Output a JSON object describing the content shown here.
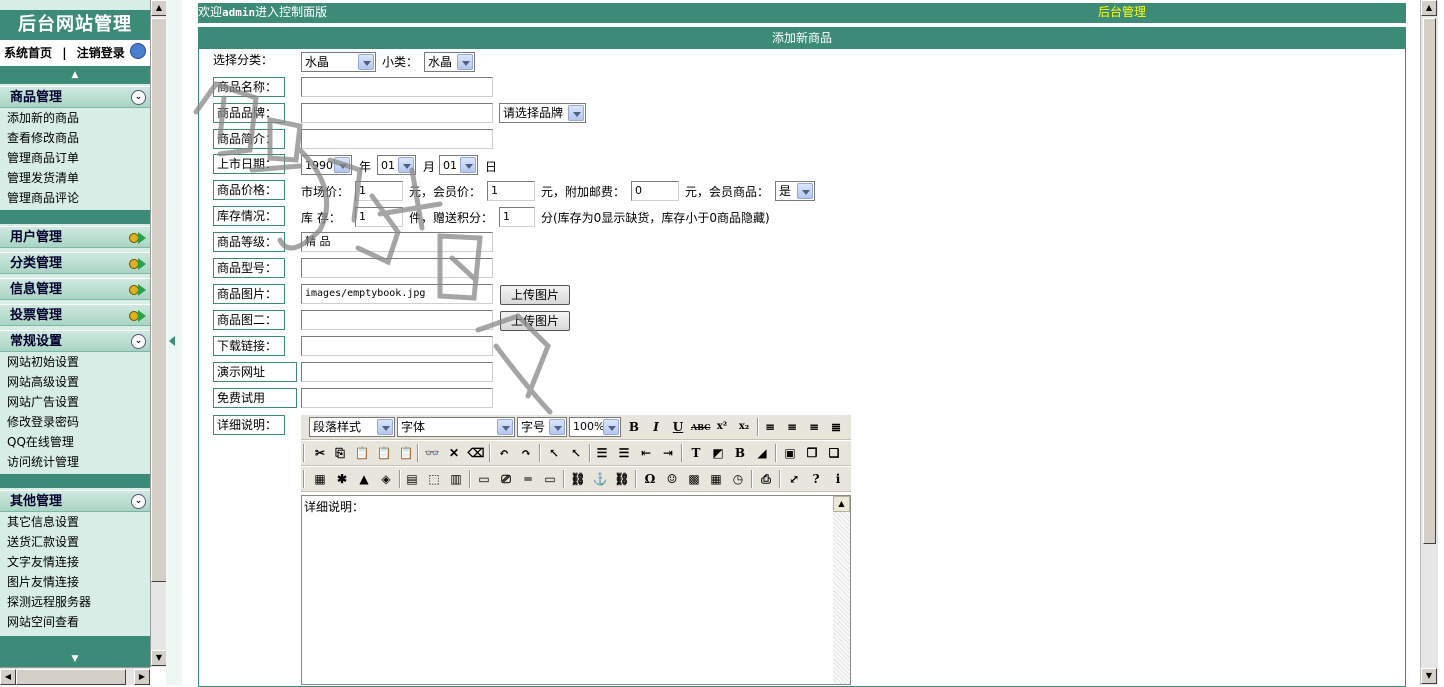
{
  "left": {
    "title": "后台网站管理",
    "home": "系统首页",
    "sep": "|",
    "logout": "注销登录",
    "groups": [
      {
        "label": "商品管理",
        "icon": "collapse-icon",
        "items": [
          "添加新的商品",
          "查看修改商品",
          "管理商品订单",
          "管理发货清单",
          "管理商品评论"
        ]
      },
      {
        "label": "用户管理",
        "icon": "expand-icon",
        "items": []
      },
      {
        "label": "分类管理",
        "icon": "expand-icon",
        "items": []
      },
      {
        "label": "信息管理",
        "icon": "expand-icon",
        "items": []
      },
      {
        "label": "投票管理",
        "icon": "expand-icon",
        "items": []
      },
      {
        "label": "常规设置",
        "icon": "collapse-icon",
        "items": [
          "网站初始设置",
          "网站高级设置",
          "网站广告设置",
          "修改登录密码",
          "QQ在线管理",
          "访问统计管理"
        ]
      },
      {
        "label": "其他管理",
        "icon": "collapse-icon",
        "items": [
          "其它信息设置",
          "送货汇款设置",
          "文字友情连接",
          "图片友情连接",
          "探测远程服务器",
          "网站空间查看"
        ]
      }
    ]
  },
  "main": {
    "welcome_pre": "欢迎",
    "welcome_user": "admin",
    "welcome_post": "进入控制面版",
    "welcome_right": "后台管理",
    "form_title": "添加新商品",
    "category_label": "选择分类：",
    "category_value": "水晶",
    "subcategory_label": "小类：",
    "subcategory_value": "水晶",
    "name_label": "商品名称：",
    "brand_label": "商品品牌：",
    "brand_select": "请选择品牌",
    "intro_label": "商品简介：",
    "date_label": "上市日期：",
    "year_value": "1990",
    "year_unit": "年",
    "month_value": "01",
    "month_unit": "月",
    "day_value": "01",
    "day_unit": "日",
    "price_label": "商品价格：",
    "market_price_label": "市场价：",
    "market_price": "1",
    "yuan1": "元，会员价：",
    "member_price": "1",
    "yuan2": "元，附加邮费：",
    "postage": "0",
    "yuan3": "元，会员商品：",
    "member_goods": "是",
    "stock_label": "库存情况：",
    "stock_prefix": "库  存：",
    "stock_value": "1",
    "stock_unit": "件，赠送积分：",
    "points_value": "1",
    "stock_note": "分(库存为0显示缺货，库存小于0商品隐藏)",
    "grade_label": "商品等级：",
    "grade_value": "精 品",
    "model_label": "商品型号：",
    "image_label": "商品图片：",
    "image_value": "images/emptybook.jpg",
    "upload1": "上传图片",
    "image2_label": "商品图二：",
    "upload2": "上传图片",
    "download_label": "下载链接：",
    "demo_label": "演示网址",
    "trial_label": "免费试用",
    "detail_label": "详细说明：",
    "editor": {
      "paragraph": "段落样式",
      "font": "字体",
      "size": "字号",
      "zoom": "100%",
      "content": "详细说明："
    }
  }
}
